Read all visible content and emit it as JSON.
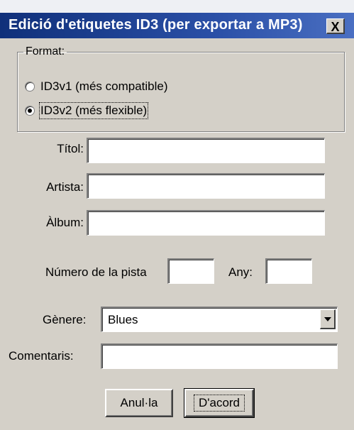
{
  "window": {
    "title": "Edició d'etiquetes ID3 (per exportar a MP3)",
    "close_label": "X"
  },
  "format_group": {
    "legend": "Format:",
    "options": [
      {
        "label": "ID3v1 (més compatible)",
        "selected": false
      },
      {
        "label": "ID3v2 (més flexible)",
        "selected": true
      }
    ]
  },
  "fields": {
    "title_label": "Títol:",
    "title_value": "",
    "artist_label": "Artista:",
    "artist_value": "",
    "album_label": "Àlbum:",
    "album_value": "",
    "track_label": "Número de la pista",
    "track_value": "",
    "year_label": "Any:",
    "year_value": "",
    "genre_label": "Gènere:",
    "genre_value": "Blues",
    "comments_label": "Comentaris:",
    "comments_value": ""
  },
  "buttons": {
    "cancel": "Anul·la",
    "ok": "D'acord"
  },
  "colors": {
    "dialog_bg": "#d4d0c8",
    "titlebar_start": "#10307a",
    "titlebar_end": "#4a6fc2"
  }
}
